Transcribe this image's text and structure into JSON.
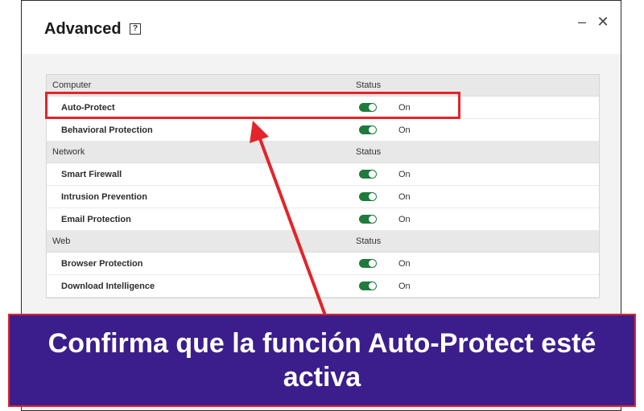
{
  "window": {
    "title": "Advanced",
    "help_glyph": "?",
    "minimize_glyph": "–",
    "close_glyph": "✕"
  },
  "sections": [
    {
      "name": "Computer",
      "status_header": "Status",
      "rows": [
        {
          "label": "Auto-Protect",
          "state": "On"
        },
        {
          "label": "Behavioral Protection",
          "state": "On"
        }
      ]
    },
    {
      "name": "Network",
      "status_header": "Status",
      "rows": [
        {
          "label": "Smart Firewall",
          "state": "On"
        },
        {
          "label": "Intrusion Prevention",
          "state": "On"
        },
        {
          "label": "Email Protection",
          "state": "On"
        }
      ]
    },
    {
      "name": "Web",
      "status_header": "Status",
      "rows": [
        {
          "label": "Browser Protection",
          "state": "On"
        },
        {
          "label": "Download Intelligence",
          "state": "On"
        }
      ]
    }
  ],
  "caption": {
    "text": "Confirma que la función Auto-Protect esté activa"
  },
  "colors": {
    "toggle_on": "#1f7a3c",
    "highlight": "#e3242b",
    "banner_bg": "#3b1e8c"
  }
}
